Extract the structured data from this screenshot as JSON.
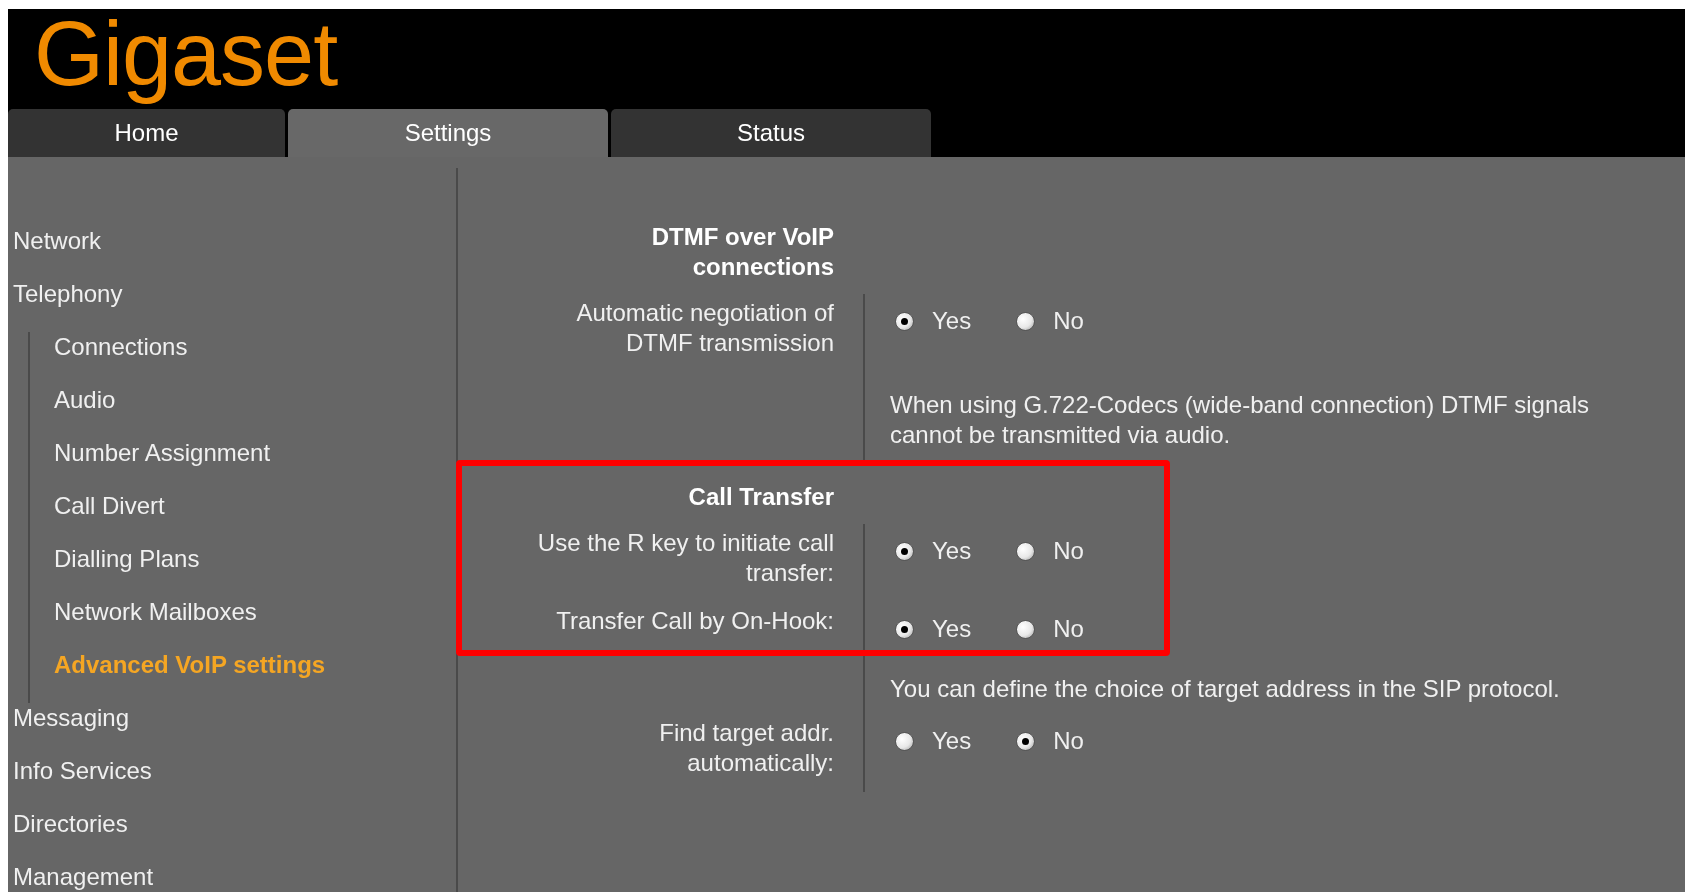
{
  "logo": "Gigaset",
  "tabs": [
    {
      "label": "Home",
      "selected": false
    },
    {
      "label": "Settings",
      "selected": true
    },
    {
      "label": "Status",
      "selected": false
    }
  ],
  "sidebar": {
    "items": [
      {
        "label": "Network",
        "selected": false
      },
      {
        "label": "Telephony",
        "selected": false,
        "children": [
          {
            "label": "Connections",
            "selected": false
          },
          {
            "label": "Audio",
            "selected": false
          },
          {
            "label": "Number Assignment",
            "selected": false
          },
          {
            "label": "Call Divert",
            "selected": false
          },
          {
            "label": "Dialling Plans",
            "selected": false
          },
          {
            "label": "Network Mailboxes",
            "selected": false
          },
          {
            "label": "Advanced VoIP settings",
            "selected": true
          }
        ]
      },
      {
        "label": "Messaging",
        "selected": false
      },
      {
        "label": "Info Services",
        "selected": false
      },
      {
        "label": "Directories",
        "selected": false
      },
      {
        "label": "Management",
        "selected": false
      }
    ]
  },
  "blocks": [
    {
      "highlighted": false,
      "rows": [
        {
          "kind": "section",
          "title": "DTMF over VoIP connections"
        },
        {
          "kind": "radio",
          "label": "Automatic negotiation of DTMF transmission",
          "options": [
            {
              "label": "Yes",
              "selected": true
            },
            {
              "label": "No",
              "selected": false
            }
          ]
        },
        {
          "kind": "note",
          "text": "When using G.722-Codecs (wide-band connection) DTMF signals cannot be transmitted via audio."
        }
      ]
    },
    {
      "highlighted": true,
      "rows": [
        {
          "kind": "section",
          "title": "Call Transfer"
        },
        {
          "kind": "radio",
          "label": "Use the R key to initiate call transfer:",
          "options": [
            {
              "label": "Yes",
              "selected": true
            },
            {
              "label": "No",
              "selected": false
            }
          ]
        },
        {
          "kind": "radio",
          "label": "Transfer Call by On-Hook:",
          "options": [
            {
              "label": "Yes",
              "selected": true
            },
            {
              "label": "No",
              "selected": false
            }
          ]
        }
      ]
    },
    {
      "highlighted": false,
      "rows": [
        {
          "kind": "note",
          "text": "You can define the choice of target address in the SIP protocol."
        },
        {
          "kind": "radio",
          "label": "Find target addr. automatically:",
          "options": [
            {
              "label": "Yes",
              "selected": false
            },
            {
              "label": "No",
              "selected": true
            }
          ]
        }
      ]
    }
  ]
}
